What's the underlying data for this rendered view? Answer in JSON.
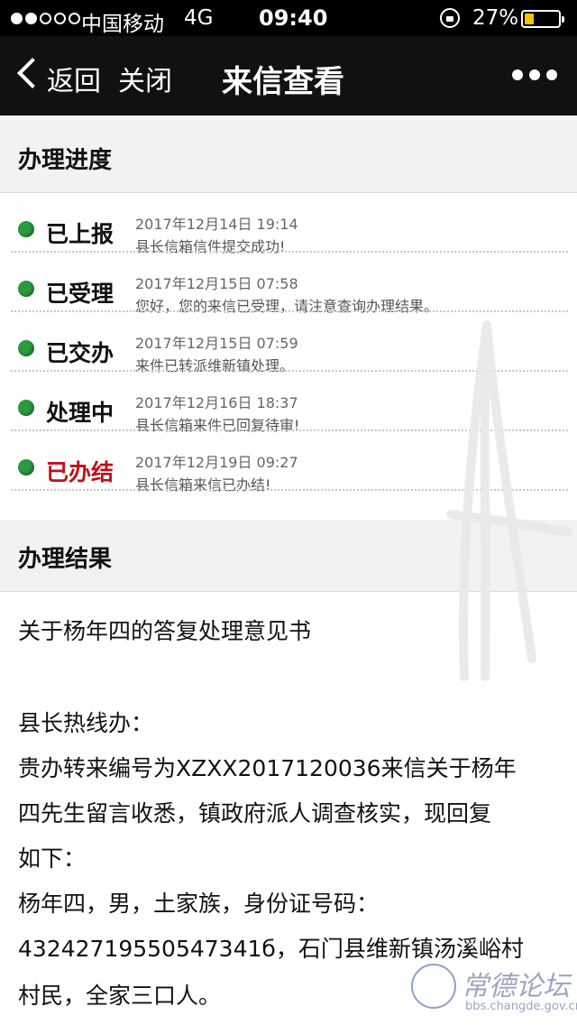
{
  "status_bar": {
    "carrier": "中国移动",
    "network": "4G",
    "time": "09:40",
    "battery_percent_text": "27%",
    "battery_level": 0.27,
    "signal_bars_filled": 2,
    "signal_bars_total": 5
  },
  "nav": {
    "back_label": "返回",
    "close_label": "关闭",
    "title": "来信查看"
  },
  "progress": {
    "header": "办理进度",
    "steps": [
      {
        "label": "已上报",
        "time": "2017年12月14日 19:14",
        "desc": "县长信箱信件提交成功!"
      },
      {
        "label": "已受理",
        "time": "2017年12月15日 07:58",
        "desc": "您好，您的来信已受理，请注意查询办理结果。"
      },
      {
        "label": "已交办",
        "time": "2017年12月15日 07:59",
        "desc": "来件已转派维新镇处理。"
      },
      {
        "label": "处理中",
        "time": "2017年12月16日 18:37",
        "desc": "县长信箱来件已回复待审!"
      },
      {
        "label": "已办结",
        "time": "2017年12月19日 09:27",
        "desc": "县长信箱来信已办结!"
      }
    ]
  },
  "result": {
    "header": "办理结果",
    "lines": [
      "关于杨年四的答复处理意见书",
      "",
      "县长热线办：",
      "贵办转来编号为XZXX2017120036来信关于杨年",
      "四先生留言收悉，镇政府派人调查核实，现回复",
      "如下：",
      "杨年四，男，土家族，身份证号码：",
      "43242719550547341б，石门县维新镇汤溪峪村",
      "村民，全家三口人。"
    ]
  },
  "watermark": {
    "title": "常德论坛",
    "url": "bbs.changde.gov.cn"
  },
  "colors": {
    "status_green": "#2b9a3f",
    "done_red": "#c0101a",
    "battery_yellow": "#f5c400",
    "nav_bg": "#111111"
  }
}
